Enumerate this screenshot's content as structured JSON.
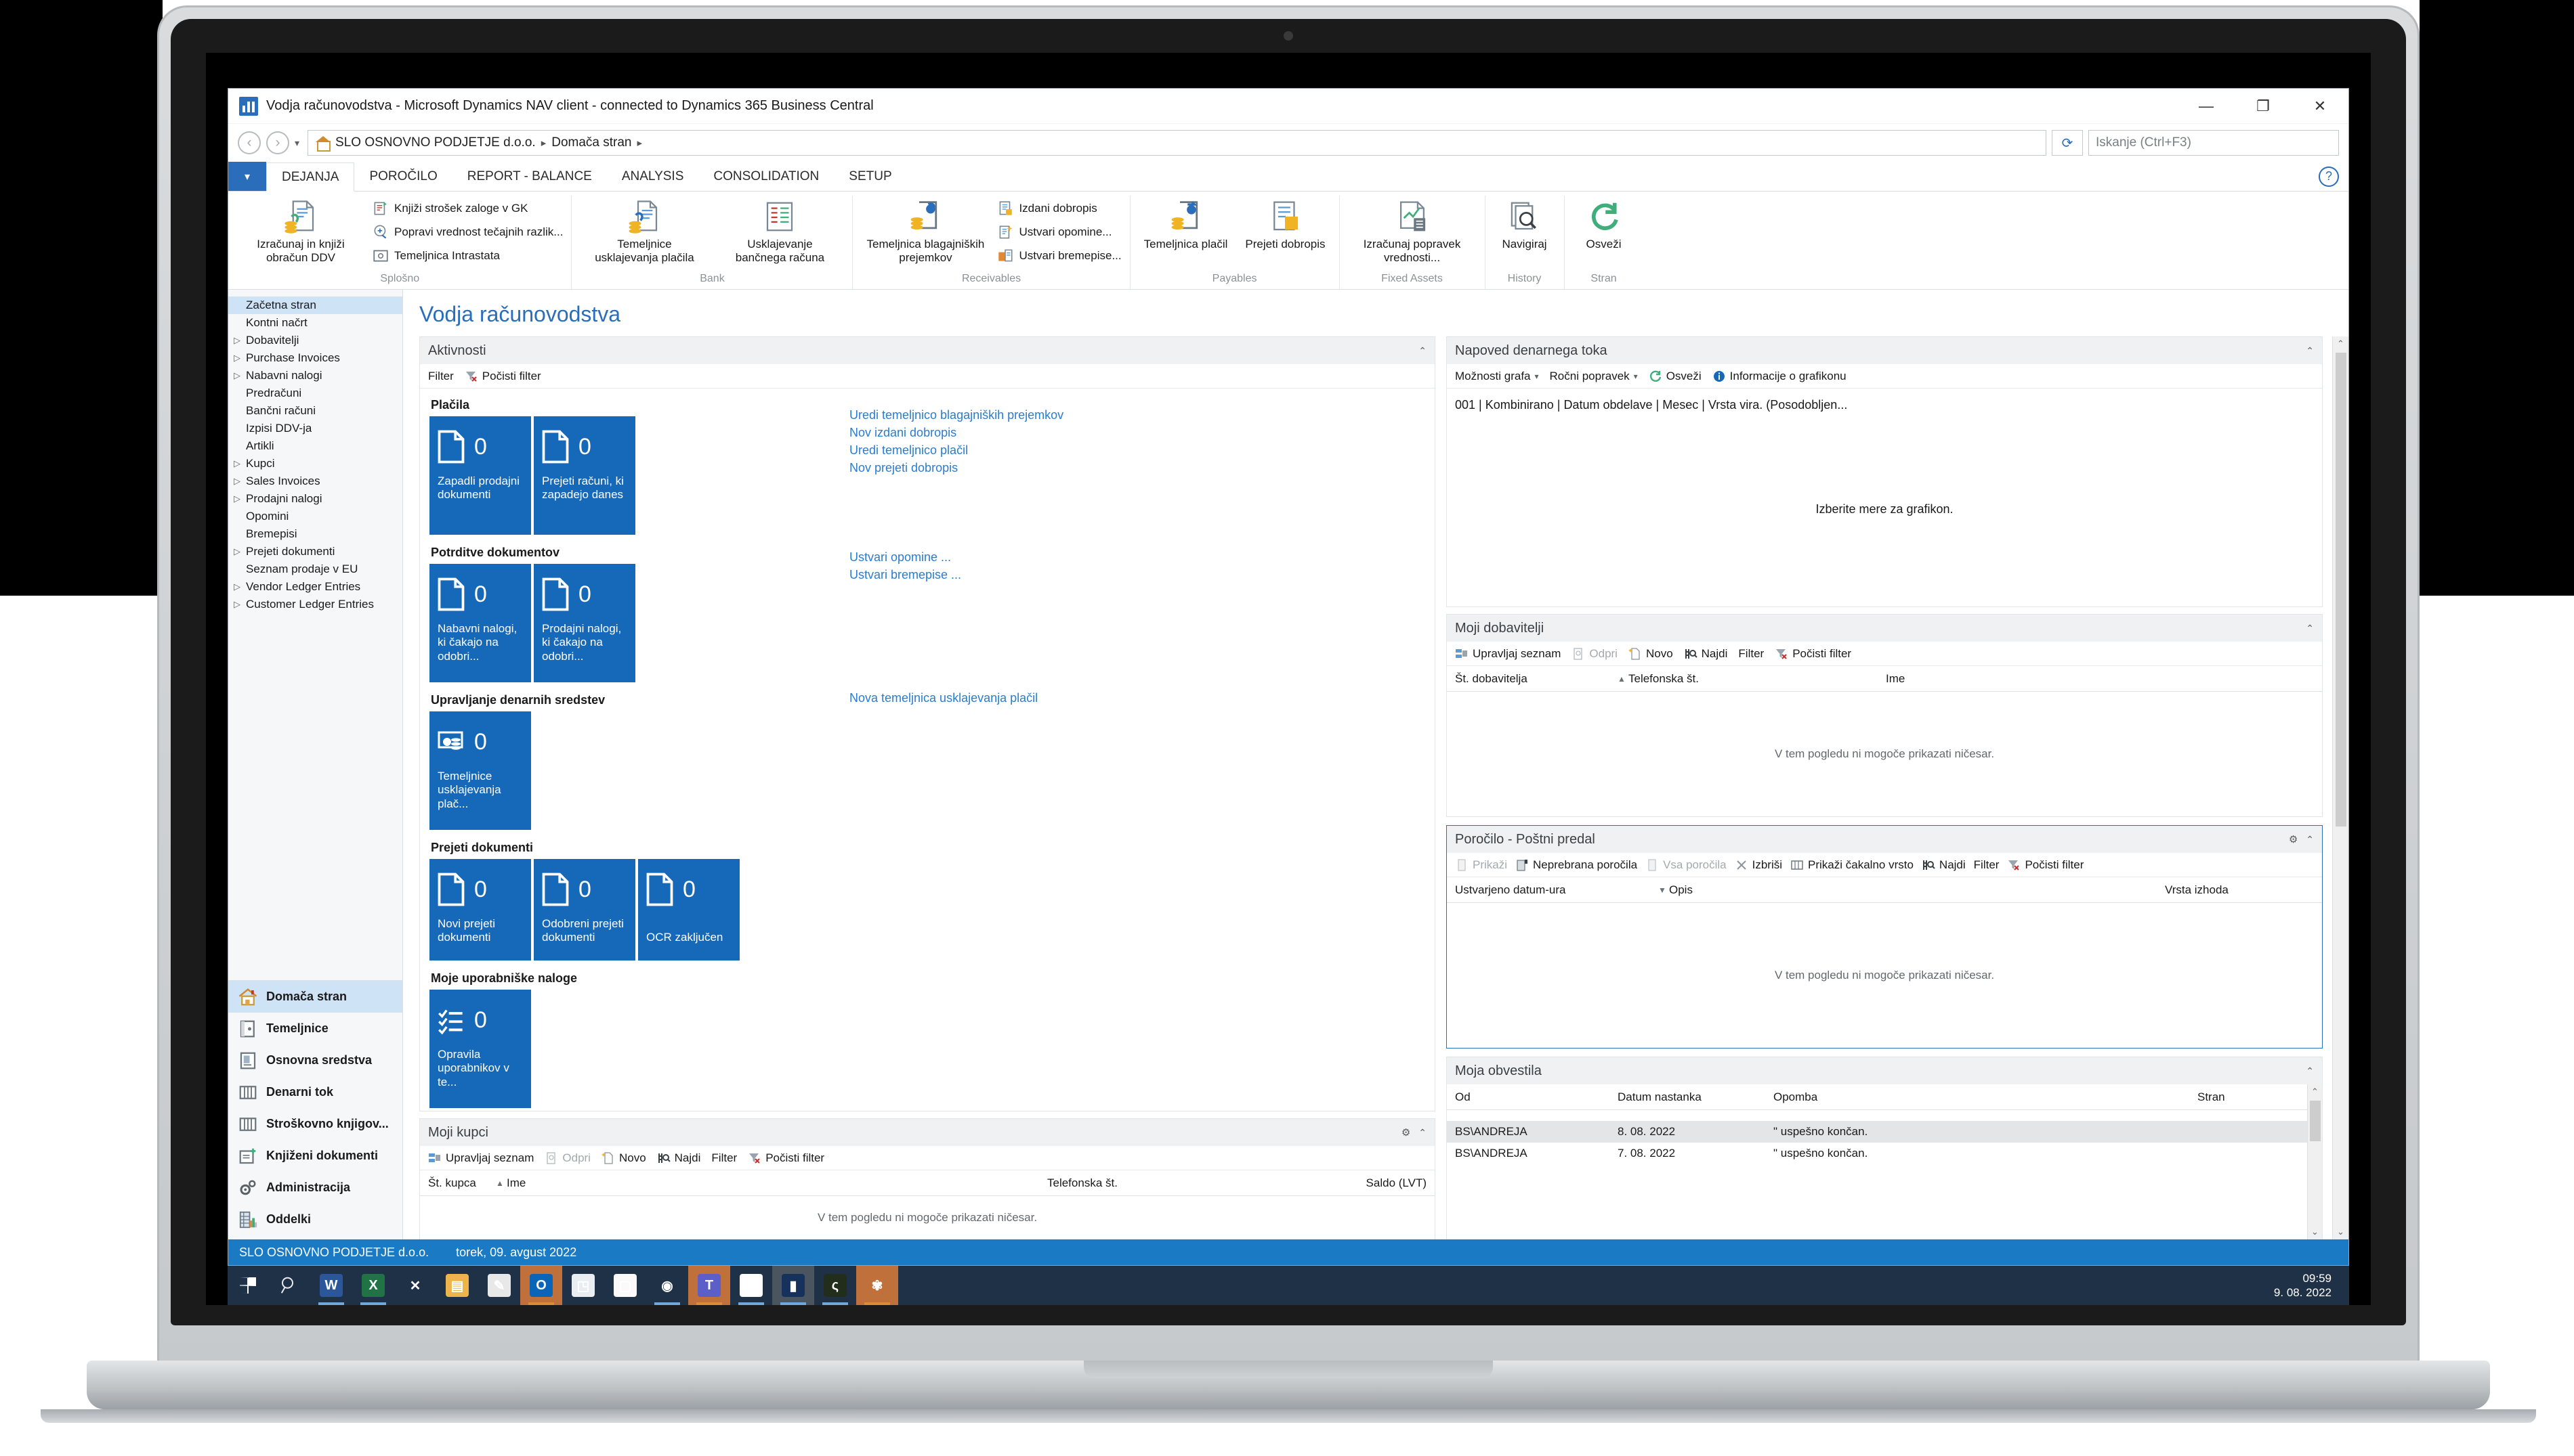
{
  "window": {
    "title": "Vodja računovodstva - Microsoft Dynamics NAV client - connected to Dynamics 365 Business Central",
    "minimize": "—",
    "maximize": "❐",
    "close": "✕"
  },
  "address": {
    "back_icon": "‹",
    "forward_icon": "›",
    "dropdown_icon": "▾",
    "home_icon": "home-icon",
    "crumb1": "SLO OSNOVNO PODJETJE d.o.o.",
    "crumb_sep": "▸",
    "crumb2": "Domača stran",
    "refresh_icon": "⟳",
    "search_placeholder": "Iskanje (Ctrl+F3)",
    "help_icon": "?"
  },
  "ribbon": {
    "dropdown": "▾",
    "tabs": [
      {
        "label": "DEJANJA",
        "active": true
      },
      {
        "label": "POROČILO",
        "active": false
      },
      {
        "label": "REPORT - BALANCE",
        "active": false
      },
      {
        "label": "ANALYSIS",
        "active": false
      },
      {
        "label": "CONSOLIDATION",
        "active": false
      },
      {
        "label": "SETUP",
        "active": false
      }
    ],
    "groups": [
      {
        "label": "Splošno",
        "big": [
          {
            "label": "Izračunaj in knjiži obračun DDV"
          }
        ],
        "small": [
          {
            "label": "Knjiži strošek zaloge v GK"
          },
          {
            "label": "Popravi vrednost tečajnih razlik..."
          },
          {
            "label": "Temeljnica Intrastata"
          }
        ]
      },
      {
        "label": "Bank",
        "big": [
          {
            "label": "Temeljnice usklajevanja plačila"
          },
          {
            "label": "Usklajevanje bančnega računa"
          }
        ],
        "small": []
      },
      {
        "label": "Receivables",
        "big": [
          {
            "label": "Temeljnica blagajniških prejemkov"
          }
        ],
        "small": [
          {
            "label": "Izdani dobropis"
          },
          {
            "label": "Ustvari opomine..."
          },
          {
            "label": "Ustvari bremepise..."
          }
        ]
      },
      {
        "label": "Payables",
        "big": [
          {
            "label": "Temeljnica plačil"
          },
          {
            "label": "Prejeti dobropis"
          }
        ],
        "small": []
      },
      {
        "label": "Fixed Assets",
        "big": [
          {
            "label": "Izračunaj popravek vrednosti..."
          }
        ],
        "small": []
      },
      {
        "label": "History",
        "big": [
          {
            "label": "Navigiraj"
          }
        ],
        "small": []
      },
      {
        "label": "Stran",
        "big": [
          {
            "label": "Osveži"
          }
        ],
        "small": []
      }
    ]
  },
  "navpane": {
    "tree": [
      {
        "label": "Začetna stran",
        "expandable": false,
        "selected": true
      },
      {
        "label": "Kontni načrt",
        "expandable": false,
        "selected": false
      },
      {
        "label": "Dobavitelji",
        "expandable": true,
        "selected": false
      },
      {
        "label": "Purchase Invoices",
        "expandable": true,
        "selected": false
      },
      {
        "label": "Nabavni nalogi",
        "expandable": true,
        "selected": false
      },
      {
        "label": "Predračuni",
        "expandable": false,
        "selected": false
      },
      {
        "label": "Bančni računi",
        "expandable": false,
        "selected": false
      },
      {
        "label": "Izpisi DDV-ja",
        "expandable": false,
        "selected": false
      },
      {
        "label": "Artikli",
        "expandable": false,
        "selected": false
      },
      {
        "label": "Kupci",
        "expandable": true,
        "selected": false
      },
      {
        "label": "Sales Invoices",
        "expandable": true,
        "selected": false
      },
      {
        "label": "Prodajni nalogi",
        "expandable": true,
        "selected": false
      },
      {
        "label": "Opomini",
        "expandable": false,
        "selected": false
      },
      {
        "label": "Bremepisi",
        "expandable": false,
        "selected": false
      },
      {
        "label": "Prejeti dokumenti",
        "expandable": true,
        "selected": false
      },
      {
        "label": "Seznam prodaje v EU",
        "expandable": false,
        "selected": false
      },
      {
        "label": "Vendor Ledger Entries",
        "expandable": true,
        "selected": false
      },
      {
        "label": "Customer Ledger Entries",
        "expandable": true,
        "selected": false
      }
    ],
    "actions": [
      {
        "label": "Domača stran",
        "icon": "home-icon",
        "selected": true
      },
      {
        "label": "Temeljnice",
        "icon": "journal-icon",
        "selected": false
      },
      {
        "label": "Osnovna sredstva",
        "icon": "fixed-assets-icon",
        "selected": false
      },
      {
        "label": "Denarni tok",
        "icon": "cashflow-icon",
        "selected": false
      },
      {
        "label": "Stroškovno knjigov...",
        "icon": "cost-accounting-icon",
        "selected": false
      },
      {
        "label": "Knjiženi dokumenti",
        "icon": "posted-documents-icon",
        "selected": false
      },
      {
        "label": "Administracija",
        "icon": "gears-icon",
        "selected": false
      },
      {
        "label": "Oddelki",
        "icon": "departments-icon",
        "selected": false
      }
    ]
  },
  "page": {
    "title": "Vodja računovodstva"
  },
  "activities": {
    "header": "Aktivnosti",
    "collapse_icon": "⌃",
    "toolbar": [
      {
        "label": "Filter",
        "icon": null,
        "dim": false
      },
      {
        "label": "Počisti filter",
        "icon": "clear-filter-icon",
        "dim": false
      }
    ],
    "groups": [
      {
        "title": "Plačila",
        "tiles": [
          {
            "value": "0",
            "label": "Zapadli prodajni dokumenti",
            "icon": "document-icon"
          },
          {
            "value": "0",
            "label": "Prejeti računi, ki zapadejo danes",
            "icon": "document-icon"
          }
        ],
        "links": [
          "Uredi temeljnico blagajniških prejemkov",
          "Nov izdani dobropis",
          "Uredi temeljnico plačil",
          "Nov prejeti dobropis"
        ]
      },
      {
        "title": "Potrditve dokumentov",
        "tiles": [
          {
            "value": "0",
            "label": "Nabavni nalogi, ki čakajo na odobri...",
            "icon": "document-icon"
          },
          {
            "value": "0",
            "label": "Prodajni nalogi, ki čakajo na odobri...",
            "icon": "document-icon"
          }
        ],
        "links": [
          "Ustvari opomine ...",
          "Ustvari bremepise ..."
        ]
      },
      {
        "title": "Upravljanje denarnih sredstev",
        "tiles": [
          {
            "value": "0",
            "label": "Temeljnice usklajevanja plač...",
            "icon": "reconciliation-icon"
          }
        ],
        "links": [
          "Nova temeljnica usklajevanja plačil"
        ]
      },
      {
        "title": "Prejeti dokumenti",
        "tiles": [
          {
            "value": "0",
            "label": "Novi prejeti dokumenti",
            "icon": "document-icon"
          },
          {
            "value": "0",
            "label": "Odobreni prejeti dokumenti",
            "icon": "document-icon"
          },
          {
            "value": "0",
            "label": "OCR zaključen",
            "icon": "document-icon"
          }
        ],
        "links": []
      },
      {
        "title": "Moje uporabniške naloge",
        "tiles": [
          {
            "value": "0",
            "label": "Opravila uporabnikov v te...",
            "icon": "checklist-icon"
          }
        ],
        "links": []
      }
    ]
  },
  "my_customers": {
    "header": "Moji kupci",
    "gear_icon": "gear-icon",
    "collapse_icon": "⌃",
    "toolbar": [
      {
        "label": "Upravljaj seznam",
        "icon": "manage-list-icon",
        "dim": false
      },
      {
        "label": "Odpri",
        "icon": "open-icon",
        "dim": true
      },
      {
        "label": "Novo",
        "icon": "new-icon",
        "dim": false
      },
      {
        "label": "Najdi",
        "icon": "find-icon",
        "dim": false
      },
      {
        "label": "Filter",
        "icon": null,
        "dim": false
      },
      {
        "label": "Počisti filter",
        "icon": "clear-filter-icon",
        "dim": false
      }
    ],
    "columns": [
      "Št. kupca",
      "Ime",
      "Telefonska št.",
      "Saldo (LVT)"
    ],
    "sort_icon": "▲",
    "empty_message": "V tem pogledu ni mogoče prikazati ničesar."
  },
  "cashflow": {
    "header": "Napoved denarnega toka",
    "collapse_icon": "⌃",
    "toolbar": [
      {
        "label": "Možnosti grafa",
        "icon": null,
        "caret": "▾"
      },
      {
        "label": "Ročni popravek",
        "icon": null,
        "caret": "▾"
      },
      {
        "label": "Osveži",
        "icon": "refresh-icon",
        "caret": null
      },
      {
        "label": "Informacije o grafikonu",
        "icon": "info-icon",
        "caret": null
      }
    ],
    "subtitle": "001 | Kombinirano | Datum obdelave | Mesec | Vrsta vira.  (Posodobljen...",
    "placeholder": "Izberite mere za grafikon."
  },
  "my_vendors": {
    "header": "Moji dobavitelji",
    "collapse_icon": "⌃",
    "toolbar": [
      {
        "label": "Upravljaj seznam",
        "icon": "manage-list-icon",
        "dim": false
      },
      {
        "label": "Odpri",
        "icon": "open-icon",
        "dim": true
      },
      {
        "label": "Novo",
        "icon": "new-icon",
        "dim": false
      },
      {
        "label": "Najdi",
        "icon": "find-icon",
        "dim": false
      },
      {
        "label": "Filter",
        "icon": null,
        "dim": false
      },
      {
        "label": "Počisti filter",
        "icon": "clear-filter-icon",
        "dim": false
      }
    ],
    "columns": [
      "Št. dobavitelja",
      "Telefonska št.",
      "Ime"
    ],
    "sort_icon": "▲",
    "empty_message": "V tem pogledu ni mogoče prikazati ničesar."
  },
  "report_inbox": {
    "header": "Poročilo - Poštni predal",
    "gear_icon": "gear-icon",
    "collapse_icon": "⌃",
    "toolbar": [
      {
        "label": "Prikaži",
        "icon": "show-icon",
        "dim": true
      },
      {
        "label": "Neprebrana poročila",
        "icon": "unread-reports-icon",
        "dim": false
      },
      {
        "label": "Vsa poročila",
        "icon": "all-reports-icon",
        "dim": true
      },
      {
        "label": "Izbriši",
        "icon": "delete-icon",
        "dim": false
      },
      {
        "label": "Prikaži čakalno vrsto",
        "icon": "queue-icon",
        "dim": false
      },
      {
        "label": "Najdi",
        "icon": "find-icon",
        "dim": false
      },
      {
        "label": "Filter",
        "icon": null,
        "dim": false
      },
      {
        "label": "Počisti filter",
        "icon": "clear-filter-icon",
        "dim": false
      }
    ],
    "columns": [
      "Ustvarjeno datum-ura",
      "Opis",
      "Vrsta izhoda"
    ],
    "sort_icon": "▼",
    "empty_message": "V tem pogledu ni mogoče prikazati ničesar."
  },
  "my_notifications": {
    "header": "Moja obvestila",
    "collapse_icon": "⌃",
    "columns": [
      "Od",
      "Datum nastanka",
      "Opomba",
      "Stran"
    ],
    "rows": [
      {
        "from": "BS\\ANDREJA",
        "date": "8. 08. 2022",
        "note": "\" uspešno končan.",
        "page": ""
      },
      {
        "from": "BS\\ANDREJA",
        "date": "7. 08. 2022",
        "note": "\" uspešno končan.",
        "page": ""
      }
    ]
  },
  "statusbar": {
    "company": "SLO OSNOVNO PODJETJE d.o.o.",
    "date": "torek, 09. avgust 2022"
  },
  "taskbar": {
    "start_icon": "windows-icon",
    "search_icon": "search-icon",
    "apps": [
      {
        "name": "word-icon",
        "glyph": "W",
        "cls": "tbi-word",
        "bg": "",
        "run": true,
        "orange": false
      },
      {
        "name": "excel-icon",
        "glyph": "X",
        "cls": "tbi-excel",
        "bg": "",
        "run": true,
        "orange": false
      },
      {
        "name": "visual-studio-icon",
        "glyph": "✕",
        "cls": "tbi-vs",
        "bg": "",
        "run": false,
        "orange": false
      },
      {
        "name": "file-explorer-icon",
        "glyph": "▤",
        "cls": "tbi-folder",
        "bg": "",
        "run": false,
        "orange": false
      },
      {
        "name": "notes-icon",
        "glyph": "✎",
        "cls": "tbi-note",
        "bg": "",
        "run": false,
        "orange": false
      },
      {
        "name": "outlook-icon",
        "glyph": "O",
        "cls": "tbi-outlook",
        "bg": "openbg",
        "run": true,
        "orange": true
      },
      {
        "name": "onenote-icon",
        "glyph": "◳",
        "cls": "tbi-doc",
        "bg": "",
        "run": false,
        "orange": false
      },
      {
        "name": "phone-link-icon",
        "glyph": "▢",
        "cls": "tbi-phone",
        "bg": "",
        "run": false,
        "orange": false
      },
      {
        "name": "edge-icon",
        "glyph": "◉",
        "cls": "tbi-edge",
        "bg": "",
        "run": true,
        "orange": false
      },
      {
        "name": "teams-icon",
        "glyph": "T",
        "cls": "tbi-teams",
        "bg": "openbg",
        "run": true,
        "orange": true
      },
      {
        "name": "chrome-icon",
        "glyph": "◎",
        "cls": "tbi-chrome",
        "bg": "",
        "run": true,
        "orange": false
      },
      {
        "name": "nav-icon",
        "glyph": "▮",
        "cls": "tbi-graph",
        "bg": "greybg",
        "run": true,
        "orange": false
      },
      {
        "name": "green-app-icon",
        "glyph": "ς",
        "cls": "tbi-green",
        "bg": "",
        "run": true,
        "orange": false
      },
      {
        "name": "paint-icon",
        "glyph": "✾",
        "cls": "tbi-paint",
        "bg": "openbg",
        "run": true,
        "orange": true
      }
    ],
    "time": "09:59",
    "date": "9. 08. 2022"
  }
}
